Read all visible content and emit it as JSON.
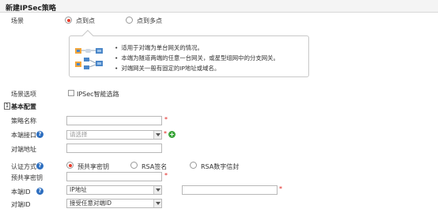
{
  "window": {
    "title": "新建IPSec策略"
  },
  "scene": {
    "label": "场景",
    "options": [
      {
        "label": "点到点",
        "selected": true
      },
      {
        "label": "点到多点",
        "selected": false
      }
    ],
    "info_bullets": [
      "适用于对端为单台网关的情况。",
      "本端为隧道两端的任意一台网关，或星型组网中的分支网关。",
      "对端网关一般有固定的IP地址或域名。"
    ]
  },
  "scene_options": {
    "label": "场景选项",
    "checkbox_label": "IPSec智能选路",
    "checked": false
  },
  "basic": {
    "section_number": "1",
    "section_title": "基本配置",
    "policy_name": {
      "label": "策略名称",
      "value": "",
      "required": "*"
    },
    "local_interface": {
      "label": "本端接口",
      "placeholder": "请选择",
      "required": "*"
    },
    "peer_address": {
      "label": "对端地址",
      "value": ""
    },
    "auth_method": {
      "label": "认证方式",
      "options": [
        {
          "label": "预共享密钥",
          "selected": true
        },
        {
          "label": "RSA签名",
          "selected": false
        },
        {
          "label": "RSA数字信封",
          "selected": false
        }
      ]
    },
    "psk": {
      "label": "预共享密钥",
      "value": "",
      "required": "*"
    },
    "local_id": {
      "label": "本端ID",
      "type_value": "IP地址",
      "value": "",
      "required": "*"
    },
    "peer_id": {
      "label": "对端ID",
      "type_value": "接受任意对端ID"
    }
  },
  "colors": {
    "accent": "#e83b2a",
    "help": "#2e6fc0",
    "add": "#3aa53a",
    "required": "#e0201b"
  },
  "icons": [
    "help-icon",
    "add-icon",
    "network-topology-icon"
  ]
}
